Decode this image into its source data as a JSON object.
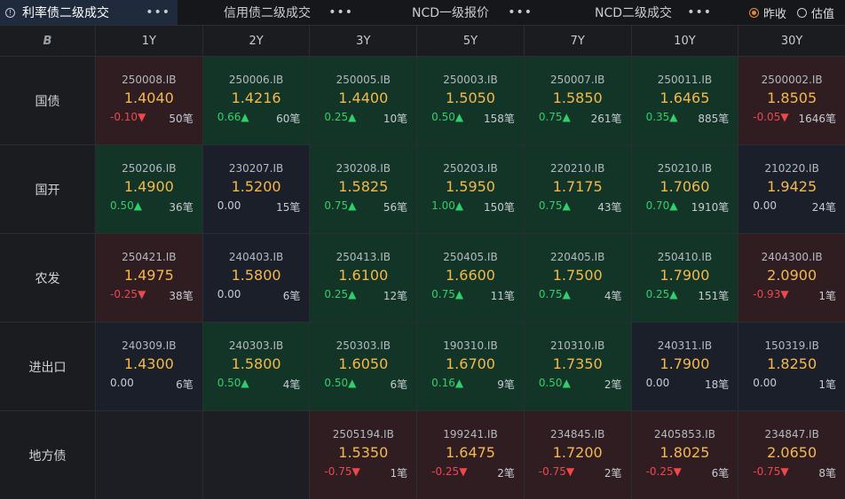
{
  "tabs": [
    {
      "label": "利率债二级成交",
      "active": true
    },
    {
      "label": "信用债二级成交",
      "active": false
    },
    {
      "label": "NCD一级报价",
      "active": false
    },
    {
      "label": "NCD二级成交",
      "active": false
    }
  ],
  "more_glyph": "•••",
  "radios": [
    {
      "label": "昨收",
      "selected": true
    },
    {
      "label": "估值",
      "selected": false
    }
  ],
  "tenors": [
    "1Y",
    "2Y",
    "3Y",
    "5Y",
    "7Y",
    "10Y",
    "30Y"
  ],
  "rows": [
    {
      "label": "国债",
      "cells": [
        {
          "code": "250008.IB",
          "yield": "1.4040",
          "change": "-0.10",
          "dir": "down",
          "count": "50笔",
          "tone": "red"
        },
        {
          "code": "250006.IB",
          "yield": "1.4216",
          "change": "0.66",
          "dir": "up",
          "count": "60笔",
          "tone": "green"
        },
        {
          "code": "250005.IB",
          "yield": "1.4400",
          "change": "0.25",
          "dir": "up",
          "count": "10笔",
          "tone": "green"
        },
        {
          "code": "250003.IB",
          "yield": "1.5050",
          "change": "0.50",
          "dir": "up",
          "count": "158笔",
          "tone": "green"
        },
        {
          "code": "250007.IB",
          "yield": "1.5850",
          "change": "0.75",
          "dir": "up",
          "count": "261笔",
          "tone": "green"
        },
        {
          "code": "250011.IB",
          "yield": "1.6465",
          "change": "0.35",
          "dir": "up",
          "count": "885笔",
          "tone": "green"
        },
        {
          "code": "2500002.IB",
          "yield": "1.8505",
          "change": "-0.05",
          "dir": "down",
          "count": "1646笔",
          "tone": "red"
        }
      ]
    },
    {
      "label": "国开",
      "cells": [
        {
          "code": "250206.IB",
          "yield": "1.4900",
          "change": "0.50",
          "dir": "up",
          "count": "36笔",
          "tone": "green"
        },
        {
          "code": "230207.IB",
          "yield": "1.5200",
          "change": "0.00",
          "dir": "flat",
          "count": "15笔",
          "tone": "neutral"
        },
        {
          "code": "230208.IB",
          "yield": "1.5825",
          "change": "0.75",
          "dir": "up",
          "count": "56笔",
          "tone": "green"
        },
        {
          "code": "250203.IB",
          "yield": "1.5950",
          "change": "1.00",
          "dir": "up",
          "count": "150笔",
          "tone": "green"
        },
        {
          "code": "220210.IB",
          "yield": "1.7175",
          "change": "0.75",
          "dir": "up",
          "count": "43笔",
          "tone": "green"
        },
        {
          "code": "250210.IB",
          "yield": "1.7060",
          "change": "0.70",
          "dir": "up",
          "count": "1910笔",
          "tone": "green"
        },
        {
          "code": "210220.IB",
          "yield": "1.9425",
          "change": "0.00",
          "dir": "flat",
          "count": "24笔",
          "tone": "neutral"
        }
      ]
    },
    {
      "label": "农发",
      "cells": [
        {
          "code": "250421.IB",
          "yield": "1.4975",
          "change": "-0.25",
          "dir": "down",
          "count": "38笔",
          "tone": "red"
        },
        {
          "code": "240403.IB",
          "yield": "1.5800",
          "change": "0.00",
          "dir": "flat",
          "count": "6笔",
          "tone": "neutral"
        },
        {
          "code": "250413.IB",
          "yield": "1.6100",
          "change": "0.25",
          "dir": "up",
          "count": "12笔",
          "tone": "green"
        },
        {
          "code": "250405.IB",
          "yield": "1.6600",
          "change": "0.75",
          "dir": "up",
          "count": "11笔",
          "tone": "green"
        },
        {
          "code": "220405.IB",
          "yield": "1.7500",
          "change": "0.75",
          "dir": "up",
          "count": "4笔",
          "tone": "green"
        },
        {
          "code": "250410.IB",
          "yield": "1.7900",
          "change": "0.25",
          "dir": "up",
          "count": "151笔",
          "tone": "green"
        },
        {
          "code": "2404300.IB",
          "yield": "2.0900",
          "change": "-0.93",
          "dir": "down",
          "count": "1笔",
          "tone": "red"
        }
      ]
    },
    {
      "label": "进出口",
      "cells": [
        {
          "code": "240309.IB",
          "yield": "1.4300",
          "change": "0.00",
          "dir": "flat",
          "count": "6笔",
          "tone": "neutral"
        },
        {
          "code": "240303.IB",
          "yield": "1.5800",
          "change": "0.50",
          "dir": "up",
          "count": "4笔",
          "tone": "green"
        },
        {
          "code": "250303.IB",
          "yield": "1.6050",
          "change": "0.50",
          "dir": "up",
          "count": "6笔",
          "tone": "green"
        },
        {
          "code": "190310.IB",
          "yield": "1.6700",
          "change": "0.16",
          "dir": "up",
          "count": "9笔",
          "tone": "green"
        },
        {
          "code": "210310.IB",
          "yield": "1.7350",
          "change": "0.50",
          "dir": "up",
          "count": "2笔",
          "tone": "green"
        },
        {
          "code": "240311.IB",
          "yield": "1.7900",
          "change": "0.00",
          "dir": "flat",
          "count": "18笔",
          "tone": "neutral"
        },
        {
          "code": "150319.IB",
          "yield": "1.8250",
          "change": "0.00",
          "dir": "flat",
          "count": "1笔",
          "tone": "neutral"
        }
      ]
    },
    {
      "label": "地方债",
      "cells": [
        null,
        null,
        {
          "code": "2505194.IB",
          "yield": "1.5350",
          "change": "-0.75",
          "dir": "down",
          "count": "1笔",
          "tone": "red"
        },
        {
          "code": "199241.IB",
          "yield": "1.6475",
          "change": "-0.25",
          "dir": "down",
          "count": "2笔",
          "tone": "red"
        },
        {
          "code": "234845.IB",
          "yield": "1.7200",
          "change": "-0.75",
          "dir": "down",
          "count": "2笔",
          "tone": "red"
        },
        {
          "code": "2405853.IB",
          "yield": "1.8025",
          "change": "-0.25",
          "dir": "down",
          "count": "6笔",
          "tone": "red"
        },
        {
          "code": "234847.IB",
          "yield": "2.0650",
          "change": "-0.75",
          "dir": "down",
          "count": "8笔",
          "tone": "red"
        }
      ]
    }
  ],
  "colors": {
    "up": "#2ed06b",
    "down": "#f0474d",
    "yield": "#f5b94a",
    "accent": "#e88a2a"
  }
}
